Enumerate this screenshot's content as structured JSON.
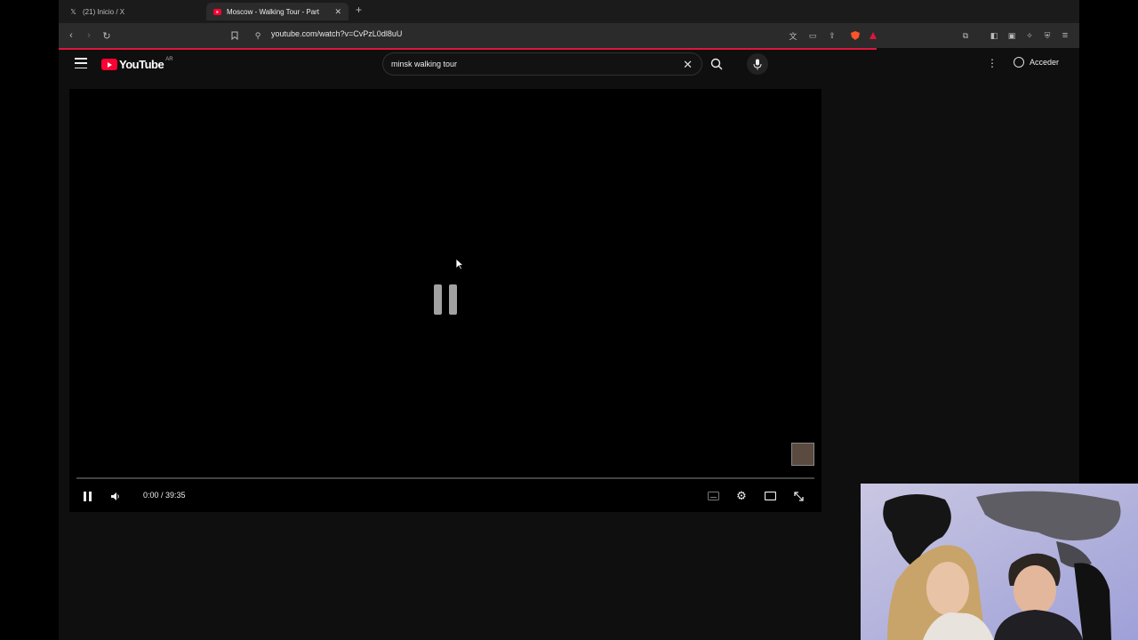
{
  "browser": {
    "tabs": [
      {
        "title": "(21) Inicio / X",
        "icon": "x-logo-icon",
        "active": false
      },
      {
        "title": "Moscow - Walking Tour - Part",
        "icon": "youtube-favicon-icon",
        "active": true
      }
    ],
    "url": "youtube.com/watch?v=CvPzL0dl8uU"
  },
  "youtube": {
    "logo_text": "YouTube",
    "country_code": "AR",
    "search_query": "minsk walking tour",
    "sign_in_label": "Acceder"
  },
  "player": {
    "time_display": "0:00 / 39:35",
    "progress": 0
  },
  "colors": {
    "brand_red": "#ff0033",
    "load_bar": "#e0153c"
  }
}
